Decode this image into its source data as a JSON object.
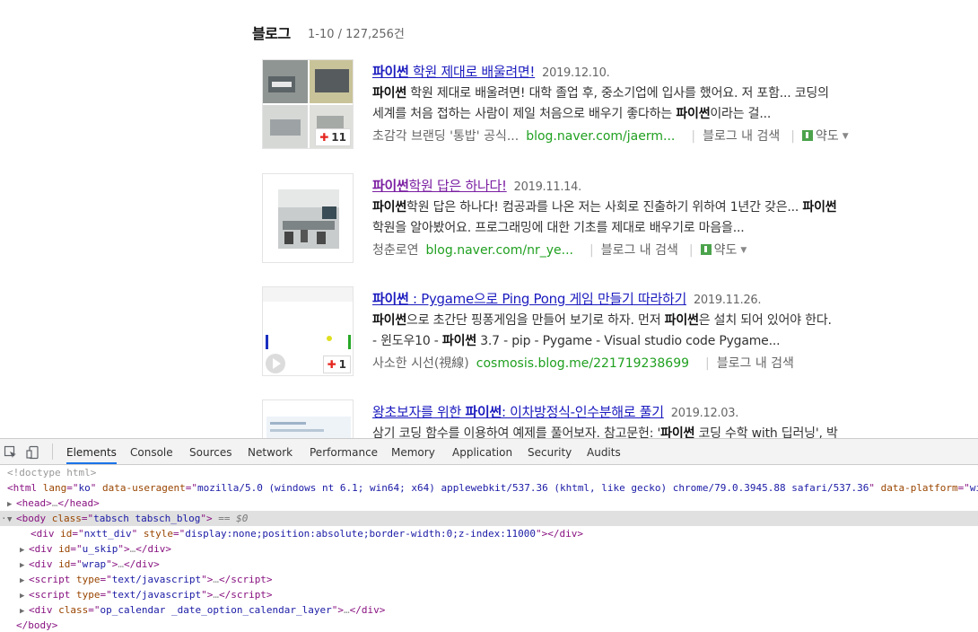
{
  "section": {
    "title": "블로그",
    "count": "1-10 / 127,256건"
  },
  "results": [
    {
      "title_parts": [
        {
          "t": "파이썬",
          "b": true
        },
        {
          "t": " 학원 제대로 배울려면!",
          "b": false
        }
      ],
      "visited": false,
      "date": "2019.12.10.",
      "snippet_line1": [
        {
          "t": "파이썬",
          "b": true
        },
        {
          "t": " 학원 제대로 배울려면! 대학 졸업 후, 중소기업에 입사를 했어요. 저 포함... 코딩의",
          "b": false
        }
      ],
      "snippet_line2": [
        {
          "t": "세계를 처음 접하는 사람이 제일 처음으로 배우기 좋다하는 ",
          "b": false
        },
        {
          "t": "파이썬",
          "b": true
        },
        {
          "t": "이라는 걸...",
          "b": false
        }
      ],
      "blog_name": "초감각 브랜딩 '통밥' 공식...",
      "url": "blog.naver.com/jaerm...",
      "search_in_blog": "블로그 내 검색",
      "map_label": "약도",
      "badge_count": "11"
    },
    {
      "title_parts": [
        {
          "t": "파이썬",
          "b": true
        },
        {
          "t": "학원 답은 하나다!",
          "b": false
        }
      ],
      "visited": true,
      "date": "2019.11.14.",
      "snippet_line1": [
        {
          "t": "파이썬",
          "b": true
        },
        {
          "t": "학원 답은 하나다! 컴공과를 나온 저는 사회로 진출하기 위하여 1년간 갖은... ",
          "b": false
        },
        {
          "t": "파이썬",
          "b": true
        }
      ],
      "snippet_line2": [
        {
          "t": "학원을 알아봤어요. 프로그래밍에 대한 기초를 제대로 배우기로 마음을...",
          "b": false
        }
      ],
      "blog_name": "청춘로연",
      "url": "blog.naver.com/nr_ye...",
      "search_in_blog": "블로그 내 검색",
      "map_label": "약도"
    },
    {
      "title_parts": [
        {
          "t": "파이썬",
          "b": true
        },
        {
          "t": " : Pygame으로 Ping Pong 게임 만들기 따라하기",
          "b": false
        }
      ],
      "visited": false,
      "date": "2019.11.26.",
      "snippet_line1": [
        {
          "t": "파이썬",
          "b": true
        },
        {
          "t": "으로 초간단 핑퐁게임을 만들어 보기로 하자. 먼저 ",
          "b": false
        },
        {
          "t": "파이썬",
          "b": true
        },
        {
          "t": "은 설치 되어 있어야 한다.",
          "b": false
        }
      ],
      "snippet_line2": [
        {
          "t": "- 윈도우10 - ",
          "b": false
        },
        {
          "t": "파이썬",
          "b": true
        },
        {
          "t": " 3.7 - pip - Pygame - Visual studio code Pygame...",
          "b": false
        }
      ],
      "blog_name": "사소한 시선(視線)",
      "url": "cosmosis.blog.me/221719238699",
      "search_in_blog": "블로그 내 검색",
      "badge_count": "1"
    },
    {
      "title_parts": [
        {
          "t": "왕초보자를 위한 ",
          "b": false
        },
        {
          "t": "파이썬",
          "b": true
        },
        {
          "t": ": 이차방정식-인수분해로 풀기",
          "b": false
        }
      ],
      "visited": false,
      "date": "2019.12.03.",
      "snippet_line1": [
        {
          "t": "삼기 코딩 함수를 이용하여 예제를 풀어보자. 참고문헌: '",
          "b": false
        },
        {
          "t": "파이썬",
          "b": true
        },
        {
          "t": " 코딩 수학 with 딥러닝', 박",
          "b": false
        }
      ]
    }
  ],
  "devtools": {
    "tabs": [
      "Elements",
      "Console",
      "Sources",
      "Network",
      "Performance",
      "Memory",
      "Application",
      "Security",
      "Audits"
    ],
    "active_tab": "Elements",
    "dom": {
      "doctype": "<!doctype html>",
      "html_tag": "html",
      "html_attrs": [
        {
          "n": "lang",
          "v": "ko"
        },
        {
          "n": "data-useragent",
          "v": "mozilla/5.0 (windows nt 6.1; win64; x64) applewebkit/537.36 (khtml, like gecko) chrome/79.0.3945.88 safari/537.36"
        },
        {
          "n": "data-platform",
          "v": "win"
        }
      ],
      "head": "head",
      "body_class": "tabsch tabsch_blog",
      "selected_suffix": "== $0",
      "children": [
        {
          "tag": "div",
          "attrs": [
            {
              "n": "id",
              "v": "nxtt_div"
            },
            {
              "n": "style",
              "v": "display:none;position:absolute;border-width:0;z-index:11000"
            }
          ],
          "collapsed": false
        },
        {
          "tag": "div",
          "attrs": [
            {
              "n": "id",
              "v": "u_skip"
            }
          ],
          "collapsed": true
        },
        {
          "tag": "div",
          "attrs": [
            {
              "n": "id",
              "v": "wrap"
            }
          ],
          "collapsed": true
        },
        {
          "tag": "script",
          "attrs": [
            {
              "n": "type",
              "v": "text/javascript"
            }
          ],
          "collapsed": true
        },
        {
          "tag": "script",
          "attrs": [
            {
              "n": "type",
              "v": "text/javascript"
            }
          ],
          "collapsed": true
        },
        {
          "tag": "div",
          "attrs": [
            {
              "n": "class",
              "v": "op_calendar _date_option_calendar_layer"
            }
          ],
          "collapsed": true
        }
      ],
      "body_close": "body"
    }
  }
}
